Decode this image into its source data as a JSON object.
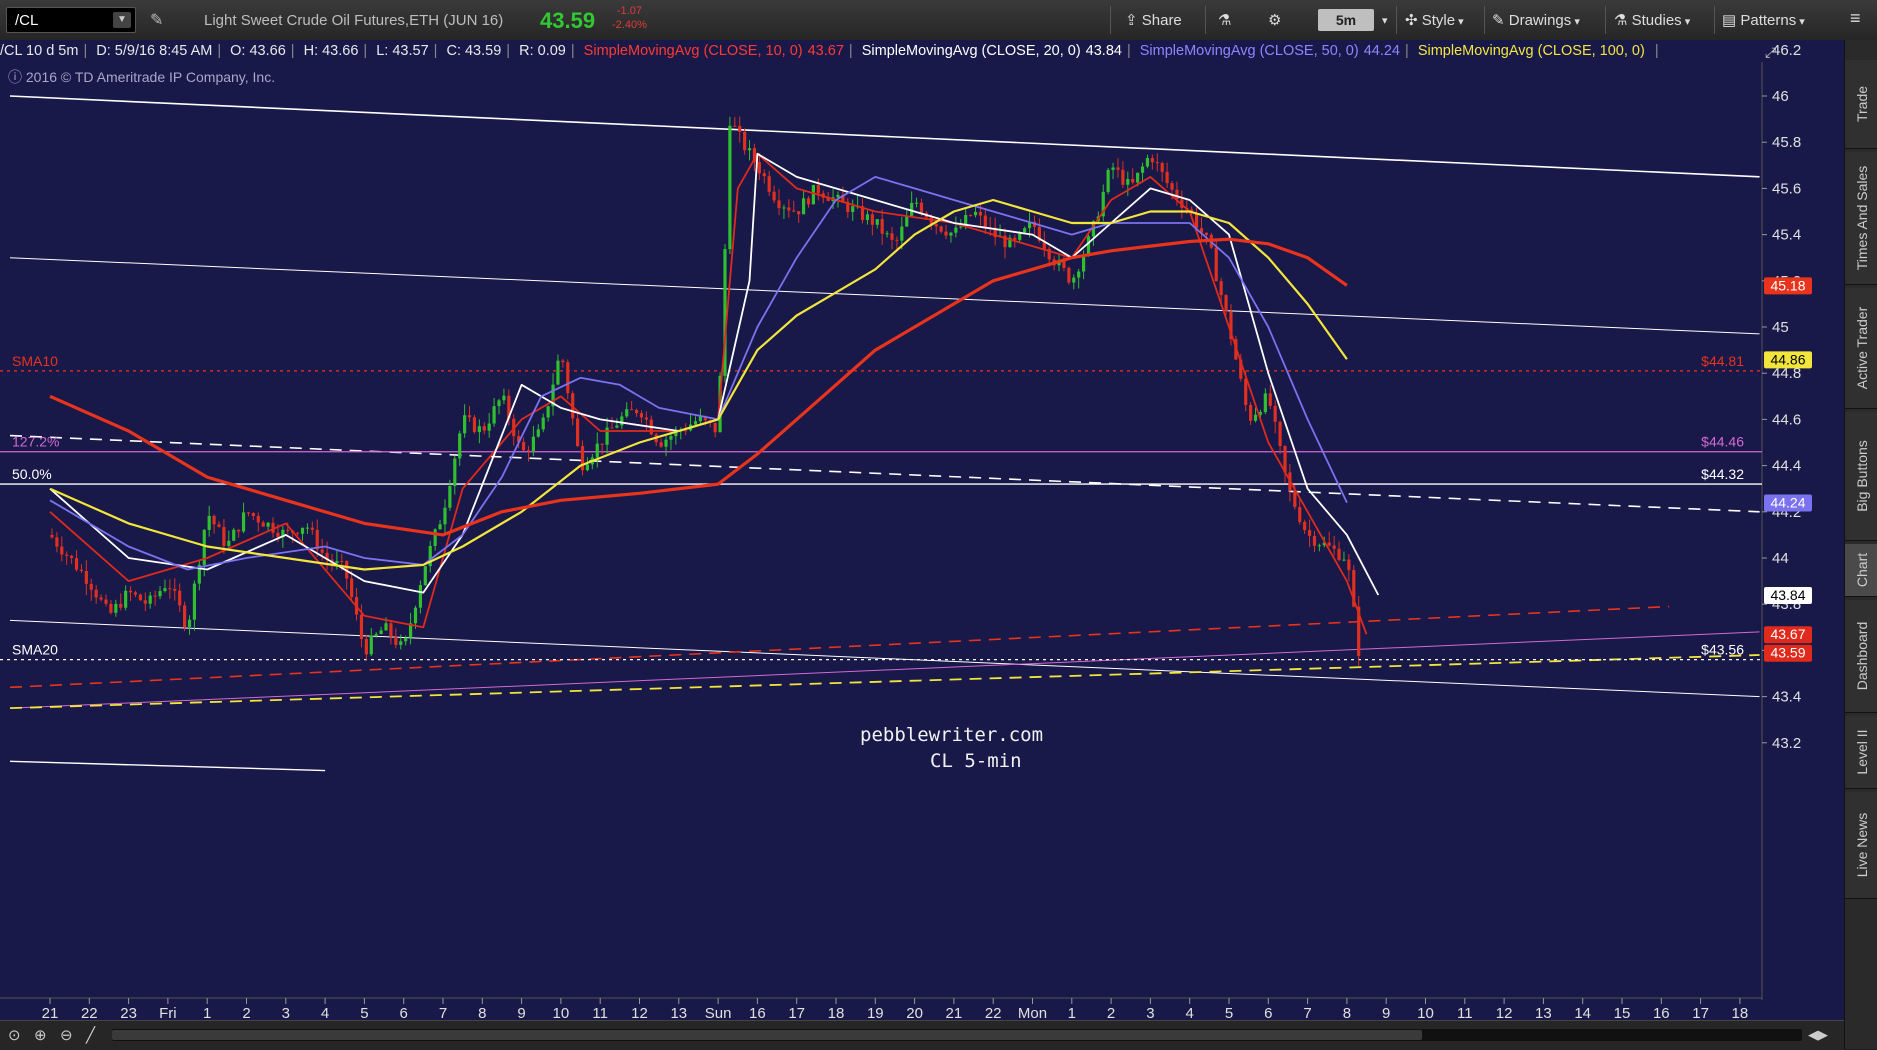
{
  "toolbar": {
    "symbol": "/CL",
    "description": "Light Sweet Crude Oil Futures,ETH (JUN 16)",
    "last": "43.59",
    "change": "-1.07",
    "change_pct": "-2.40%",
    "share": "Share",
    "timeframe": "5m",
    "style": "Style",
    "drawings": "Drawings",
    "studies": "Studies",
    "patterns": "Patterns"
  },
  "infobar": {
    "symbol": "/CL 10 d 5m",
    "date": "D: 5/9/16 8:45 AM",
    "open": "O: 43.66",
    "high": "H: 43.66",
    "low": "L: 43.57",
    "close": "C: 43.59",
    "range": "R: 0.09",
    "sma10_label": "SimpleMovingAvg (CLOSE, 10, 0)",
    "sma10_value": "43.67",
    "sma20_label": "SimpleMovingAvg (CLOSE, 20, 0)",
    "sma20_value": "43.84",
    "sma50_label": "SimpleMovingAvg (CLOSE, 50, 0)",
    "sma50_value": "44.24",
    "sma100_label": "SimpleMovingAvg (CLOSE, 100, 0)",
    "sma100_value": ""
  },
  "copyright": "2016 © TD Ameritrade IP Company, Inc.",
  "watermark": {
    "line1": "pebblewriter.com",
    "line2": "CL 5-min"
  },
  "sidebar": [
    "Trade",
    "Times And Sales",
    "Active Trader",
    "Big Buttons",
    "Chart",
    "Dashboard",
    "Level II",
    "Live News"
  ],
  "colors": {
    "background": "#181849",
    "sma10": "#e02a1c",
    "sma20": "#ffffff",
    "sma50": "#7b72f0",
    "sma100": "#f2e63c",
    "sma200_thick": "#e8341c",
    "fib": "#d26ad2",
    "up_candle": "#2fbf2f",
    "down_candle": "#e03020",
    "green_badge": "#31c831"
  },
  "chart_data": {
    "type": "candlestick",
    "title": "Light Sweet Crude Oil Futures,ETH (JUN 16)",
    "ylim": [
      43.0,
      46.3
    ],
    "y_ticks": [
      "46.2",
      "46",
      "45.8",
      "45.6",
      "45.4",
      "45.2",
      "45",
      "44.8",
      "44.6",
      "44.4",
      "44.2",
      "44",
      "43.8",
      "43.6",
      "43.4",
      "43.2"
    ],
    "x_ticks": [
      "21",
      "22",
      "23",
      "Fri",
      "1",
      "2",
      "3",
      "4",
      "5",
      "6",
      "7",
      "8",
      "9",
      "10",
      "11",
      "12",
      "13",
      "Sun",
      "16",
      "17",
      "18",
      "19",
      "20",
      "21",
      "22",
      "Mon",
      "1",
      "2",
      "3",
      "4",
      "5",
      "6",
      "7",
      "8",
      "9",
      "10",
      "11",
      "12",
      "13",
      "14",
      "15",
      "16",
      "17",
      "18"
    ],
    "x_tick_index": [
      0,
      1,
      2,
      3,
      4,
      5,
      6,
      7,
      8,
      9,
      10,
      11,
      12,
      13,
      14,
      15,
      16,
      17,
      18,
      19,
      20,
      21,
      22,
      23,
      24,
      25,
      26,
      27,
      28,
      29,
      30,
      31,
      32,
      33,
      34,
      35,
      36,
      37,
      38,
      39,
      40,
      41,
      42,
      43
    ],
    "close_path": [
      [
        0,
        44.1
      ],
      [
        1,
        43.9
      ],
      [
        1.5,
        43.75
      ],
      [
        2,
        43.85
      ],
      [
        2.5,
        43.8
      ],
      [
        3,
        43.9
      ],
      [
        3.5,
        43.7
      ],
      [
        4,
        44.2
      ],
      [
        4.5,
        44.05
      ],
      [
        5,
        44.2
      ],
      [
        5.5,
        44.15
      ],
      [
        6,
        44.1
      ],
      [
        6.5,
        44.15
      ],
      [
        7,
        44.0
      ],
      [
        7.5,
        43.95
      ],
      [
        8,
        43.6
      ],
      [
        8.5,
        43.7
      ],
      [
        9,
        43.6
      ],
      [
        9.5,
        43.95
      ],
      [
        10,
        44.2
      ],
      [
        10.5,
        44.6
      ],
      [
        11,
        44.55
      ],
      [
        11.5,
        44.7
      ],
      [
        12,
        44.45
      ],
      [
        12.5,
        44.55
      ],
      [
        13,
        44.9
      ],
      [
        13.5,
        44.4
      ],
      [
        14,
        44.5
      ],
      [
        14.5,
        44.6
      ],
      [
        15,
        44.65
      ],
      [
        15.5,
        44.5
      ],
      [
        16,
        44.55
      ],
      [
        16.5,
        44.6
      ],
      [
        17,
        44.55
      ],
      [
        17.3,
        45.9
      ],
      [
        17.6,
        45.8
      ],
      [
        18,
        45.7
      ],
      [
        18.5,
        45.55
      ],
      [
        19,
        45.5
      ],
      [
        19.5,
        45.6
      ],
      [
        20,
        45.55
      ],
      [
        20.5,
        45.5
      ],
      [
        21,
        45.45
      ],
      [
        21.5,
        45.35
      ],
      [
        22,
        45.55
      ],
      [
        22.5,
        45.45
      ],
      [
        23,
        45.4
      ],
      [
        23.5,
        45.5
      ],
      [
        24,
        45.4
      ],
      [
        24.5,
        45.35
      ],
      [
        25,
        45.45
      ],
      [
        25.5,
        45.3
      ],
      [
        26,
        45.2
      ],
      [
        26.5,
        45.4
      ],
      [
        27,
        45.7
      ],
      [
        27.5,
        45.6
      ],
      [
        28,
        45.75
      ],
      [
        28.5,
        45.6
      ],
      [
        29,
        45.5
      ],
      [
        29.5,
        45.35
      ],
      [
        30,
        45.0
      ],
      [
        30.5,
        44.6
      ],
      [
        31,
        44.7
      ],
      [
        31.5,
        44.3
      ],
      [
        32,
        44.1
      ],
      [
        32.5,
        44.05
      ],
      [
        33,
        44.0
      ],
      [
        33.3,
        43.6
      ]
    ],
    "series": [
      {
        "name": "SimpleMovingAvg (CLOSE, 10, 0)",
        "color": "#e02a1c",
        "values": [
          [
            0,
            44.2
          ],
          [
            2,
            43.9
          ],
          [
            4,
            44.0
          ],
          [
            6,
            44.15
          ],
          [
            8,
            43.75
          ],
          [
            9.5,
            43.7
          ],
          [
            10.5,
            44.3
          ],
          [
            12,
            44.6
          ],
          [
            13,
            44.7
          ],
          [
            14,
            44.55
          ],
          [
            16,
            44.55
          ],
          [
            17,
            44.6
          ],
          [
            17.5,
            45.6
          ],
          [
            18,
            45.75
          ],
          [
            19,
            45.6
          ],
          [
            21,
            45.5
          ],
          [
            23,
            45.45
          ],
          [
            25,
            45.35
          ],
          [
            26,
            45.3
          ],
          [
            27,
            45.55
          ],
          [
            28,
            45.65
          ],
          [
            29,
            45.5
          ],
          [
            30,
            45.0
          ],
          [
            31,
            44.5
          ],
          [
            32,
            44.2
          ],
          [
            33,
            43.9
          ],
          [
            33.5,
            43.67
          ]
        ]
      },
      {
        "name": "SimpleMovingAvg (CLOSE, 20, 0)",
        "color": "#ffffff",
        "values": [
          [
            0,
            44.3
          ],
          [
            2,
            44.0
          ],
          [
            4,
            43.95
          ],
          [
            6,
            44.1
          ],
          [
            8,
            43.9
          ],
          [
            9.5,
            43.85
          ],
          [
            10.5,
            44.1
          ],
          [
            12,
            44.75
          ],
          [
            13,
            44.65
          ],
          [
            14,
            44.6
          ],
          [
            16,
            44.55
          ],
          [
            17,
            44.6
          ],
          [
            17.8,
            45.2
          ],
          [
            18,
            45.75
          ],
          [
            19,
            45.65
          ],
          [
            21,
            45.55
          ],
          [
            23,
            45.45
          ],
          [
            25,
            45.4
          ],
          [
            26,
            45.3
          ],
          [
            27,
            45.45
          ],
          [
            28,
            45.6
          ],
          [
            29,
            45.55
          ],
          [
            30,
            45.4
          ],
          [
            31,
            44.8
          ],
          [
            32,
            44.3
          ],
          [
            33,
            44.1
          ],
          [
            33.8,
            43.84
          ]
        ]
      },
      {
        "name": "SimpleMovingAvg (CLOSE, 50, 0)",
        "color": "#7b72f0",
        "values": [
          [
            0,
            44.25
          ],
          [
            2,
            44.05
          ],
          [
            3.5,
            43.95
          ],
          [
            5,
            44.0
          ],
          [
            7,
            44.05
          ],
          [
            8,
            44.0
          ],
          [
            9.5,
            43.97
          ],
          [
            10.5,
            44.1
          ],
          [
            11.5,
            44.35
          ],
          [
            12.5,
            44.7
          ],
          [
            13.5,
            44.78
          ],
          [
            14.5,
            44.75
          ],
          [
            15.5,
            44.65
          ],
          [
            17,
            44.6
          ],
          [
            18,
            45.0
          ],
          [
            19,
            45.3
          ],
          [
            20,
            45.55
          ],
          [
            21,
            45.65
          ],
          [
            22,
            45.6
          ],
          [
            23,
            45.55
          ],
          [
            24,
            45.5
          ],
          [
            25,
            45.45
          ],
          [
            26,
            45.4
          ],
          [
            27,
            45.45
          ],
          [
            28,
            45.45
          ],
          [
            29,
            45.45
          ],
          [
            30,
            45.3
          ],
          [
            31,
            45.0
          ],
          [
            32,
            44.6
          ],
          [
            33,
            44.24
          ]
        ]
      },
      {
        "name": "SimpleMovingAvg (CLOSE, 100, 0)",
        "color": "#f2e63c",
        "values": [
          [
            0,
            44.3
          ],
          [
            2,
            44.15
          ],
          [
            4,
            44.05
          ],
          [
            6,
            44.0
          ],
          [
            8,
            43.95
          ],
          [
            9.5,
            43.97
          ],
          [
            10.5,
            44.05
          ],
          [
            12,
            44.2
          ],
          [
            13.5,
            44.4
          ],
          [
            15,
            44.5
          ],
          [
            17,
            44.6
          ],
          [
            18,
            44.9
          ],
          [
            19,
            45.05
          ],
          [
            20,
            45.15
          ],
          [
            21,
            45.25
          ],
          [
            22,
            45.4
          ],
          [
            23,
            45.5
          ],
          [
            24,
            45.55
          ],
          [
            25,
            45.5
          ],
          [
            26,
            45.45
          ],
          [
            27,
            45.45
          ],
          [
            28,
            45.5
          ],
          [
            29,
            45.5
          ],
          [
            30,
            45.45
          ],
          [
            31,
            45.3
          ],
          [
            32,
            45.1
          ],
          [
            33,
            44.86
          ]
        ]
      },
      {
        "name": "",
        "color": "#e8341c",
        "values": [
          [
            0,
            44.7
          ],
          [
            2,
            44.55
          ],
          [
            4,
            44.35
          ],
          [
            6,
            44.25
          ],
          [
            8,
            44.15
          ],
          [
            10,
            44.1
          ],
          [
            11.5,
            44.2
          ],
          [
            13,
            44.25
          ],
          [
            15,
            44.28
          ],
          [
            17,
            44.32
          ],
          [
            18,
            44.45
          ],
          [
            19,
            44.6
          ],
          [
            20,
            44.75
          ],
          [
            21,
            44.9
          ],
          [
            22,
            45.0
          ],
          [
            23,
            45.1
          ],
          [
            24,
            45.2
          ],
          [
            25,
            45.25
          ],
          [
            26,
            45.3
          ],
          [
            27,
            45.33
          ],
          [
            28,
            45.35
          ],
          [
            29,
            45.37
          ],
          [
            30,
            45.38
          ],
          [
            31,
            45.36
          ],
          [
            32,
            45.3
          ],
          [
            33,
            45.18
          ]
        ]
      }
    ],
    "horizontal_lines": [
      {
        "label": "SMA10",
        "value": 44.81,
        "display": "$44.81",
        "style": "dotted",
        "color": "#e8341c"
      },
      {
        "label": "127.2%",
        "value": 44.46,
        "display": "$44.46",
        "style": "solid",
        "color": "#d26ad2"
      },
      {
        "label": "50.0%",
        "value": 44.32,
        "display": "$44.32",
        "style": "solid",
        "color": "#ffffff"
      },
      {
        "label": "SMA20",
        "value": 43.56,
        "display": "$43.56",
        "style": "dotted",
        "color": "#ffffff"
      }
    ],
    "trend_lines": [
      {
        "from": [
          0,
          46.0
        ],
        "to": [
          43.5,
          45.65
        ],
        "color": "#ffffff",
        "width": 1.6,
        "dash": ""
      },
      {
        "from": [
          0,
          45.3
        ],
        "to": [
          43.5,
          44.97
        ],
        "color": "#ffffff",
        "width": 1,
        "dash": ""
      },
      {
        "from": [
          0,
          44.53
        ],
        "to": [
          43.5,
          44.2
        ],
        "color": "#ffffff",
        "width": 1.6,
        "dash": "12,8"
      },
      {
        "from": [
          0,
          43.73
        ],
        "to": [
          43.5,
          43.4
        ],
        "color": "#ffffff",
        "width": 1,
        "dash": ""
      },
      {
        "from": [
          0,
          43.44
        ],
        "to": [
          41.2,
          43.79
        ],
        "color": "#e8341c",
        "width": 1.6,
        "dash": "12,8"
      },
      {
        "from": [
          0,
          43.35
        ],
        "to": [
          43.5,
          43.68
        ],
        "color": "#d26ad2",
        "width": 1,
        "dash": ""
      },
      {
        "from": [
          0,
          43.35
        ],
        "to": [
          43.5,
          43.58
        ],
        "color": "#f2e63c",
        "width": 1.8,
        "dash": "12,8"
      },
      {
        "from": [
          0,
          43.12
        ],
        "to": [
          7,
          43.08
        ],
        "color": "#ffffff",
        "width": 1.4,
        "dash": ""
      }
    ],
    "price_badges": [
      {
        "value": 45.18,
        "display": "45.18",
        "bg": "#e8341c",
        "fg": "#ffffff"
      },
      {
        "value": 44.86,
        "display": "44.86",
        "bg": "#f2e63c",
        "fg": "#000000"
      },
      {
        "value": 44.24,
        "display": "44.24",
        "bg": "#7b72f0",
        "fg": "#ffffff"
      },
      {
        "value": 43.84,
        "display": "43.84",
        "bg": "#ffffff",
        "fg": "#000000"
      },
      {
        "value": 43.67,
        "display": "43.67",
        "bg": "#e02a1c",
        "fg": "#ffffff"
      },
      {
        "value": 43.59,
        "display": "43.59",
        "bg": "#e02a1c",
        "fg": "#ffffff"
      }
    ]
  }
}
